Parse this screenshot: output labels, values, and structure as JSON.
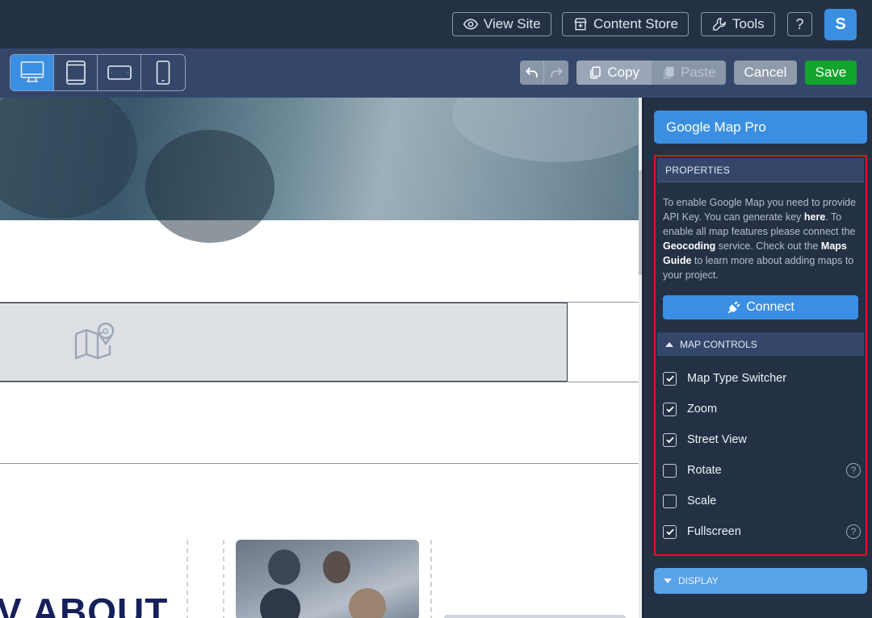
{
  "topbar": {
    "view_site": "View Site",
    "content_store": "Content Store",
    "tools": "Tools",
    "help": "?",
    "avatar": "S"
  },
  "toolbar": {
    "copy": "Copy",
    "paste": "Paste",
    "cancel": "Cancel",
    "save": "Save"
  },
  "canvas": {
    "heading_fragment": "V ABOUT"
  },
  "panel": {
    "title": "Google Map Pro",
    "properties_header": "PROPERTIES",
    "info": {
      "t1": "To enable Google Map you need to provide API Key. You can generate key ",
      "link_here": "here",
      "t2": ". To enable all map features please connect the ",
      "link_geocoding": "Geocoding",
      "t3": " service. Check out the ",
      "link_maps_guide": "Maps Guide",
      "t4": " to learn more about adding maps to your project."
    },
    "connect": "Connect",
    "map_controls_header": "MAP CONTROLS",
    "controls": [
      {
        "label": "Map Type Switcher",
        "checked": true,
        "help": false
      },
      {
        "label": "Zoom",
        "checked": true,
        "help": false
      },
      {
        "label": "Street View",
        "checked": true,
        "help": false
      },
      {
        "label": "Rotate",
        "checked": false,
        "help": true
      },
      {
        "label": "Scale",
        "checked": false,
        "help": false
      },
      {
        "label": "Fullscreen",
        "checked": true,
        "help": true
      }
    ],
    "display_header": "DISPLAY"
  },
  "colors": {
    "accent": "#3b8fe2",
    "save": "#12a52c",
    "highlight_border": "#e5131e"
  },
  "icons": {
    "view_site": "eye-icon",
    "content_store": "store-icon",
    "tools": "wrench-icon",
    "map_placeholder": "map-pin-icon",
    "connect": "plug-icon"
  }
}
